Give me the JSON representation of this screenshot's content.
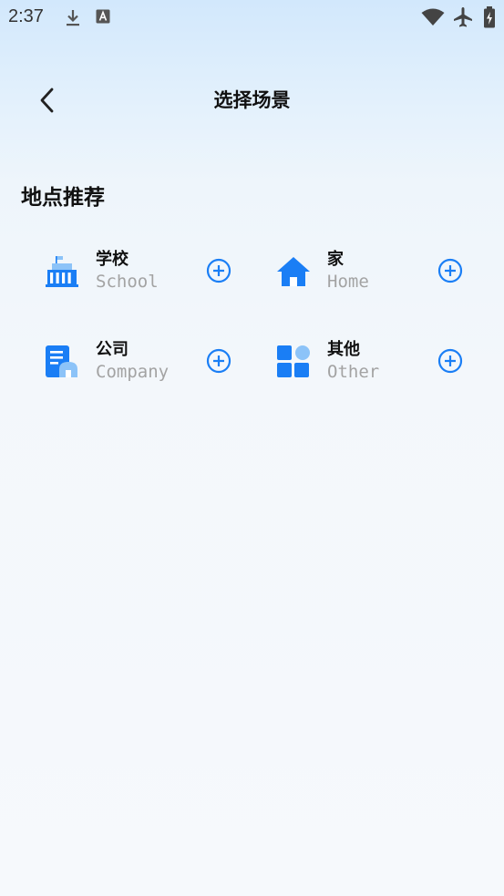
{
  "status_bar": {
    "time": "2:37",
    "left_icons": [
      "download-icon",
      "text-a-icon"
    ],
    "right_icons": [
      "wifi-icon",
      "airplane-icon",
      "battery-charging-icon"
    ]
  },
  "header": {
    "back_icon": "chevron-left-icon",
    "title": "选择场景"
  },
  "section": {
    "title": "地点推荐"
  },
  "scenes": [
    {
      "name": "学校",
      "english": "School",
      "icon": "school-icon"
    },
    {
      "name": "家",
      "english": "Home",
      "icon": "home-icon"
    },
    {
      "name": "公司",
      "english": "Company",
      "icon": "company-icon"
    },
    {
      "name": "其他",
      "english": "Other",
      "icon": "other-icon"
    }
  ],
  "colors": {
    "accent": "#1a7ef5",
    "accent_light": "#8cc3f8",
    "secondary_text": "#a3a3a3"
  }
}
